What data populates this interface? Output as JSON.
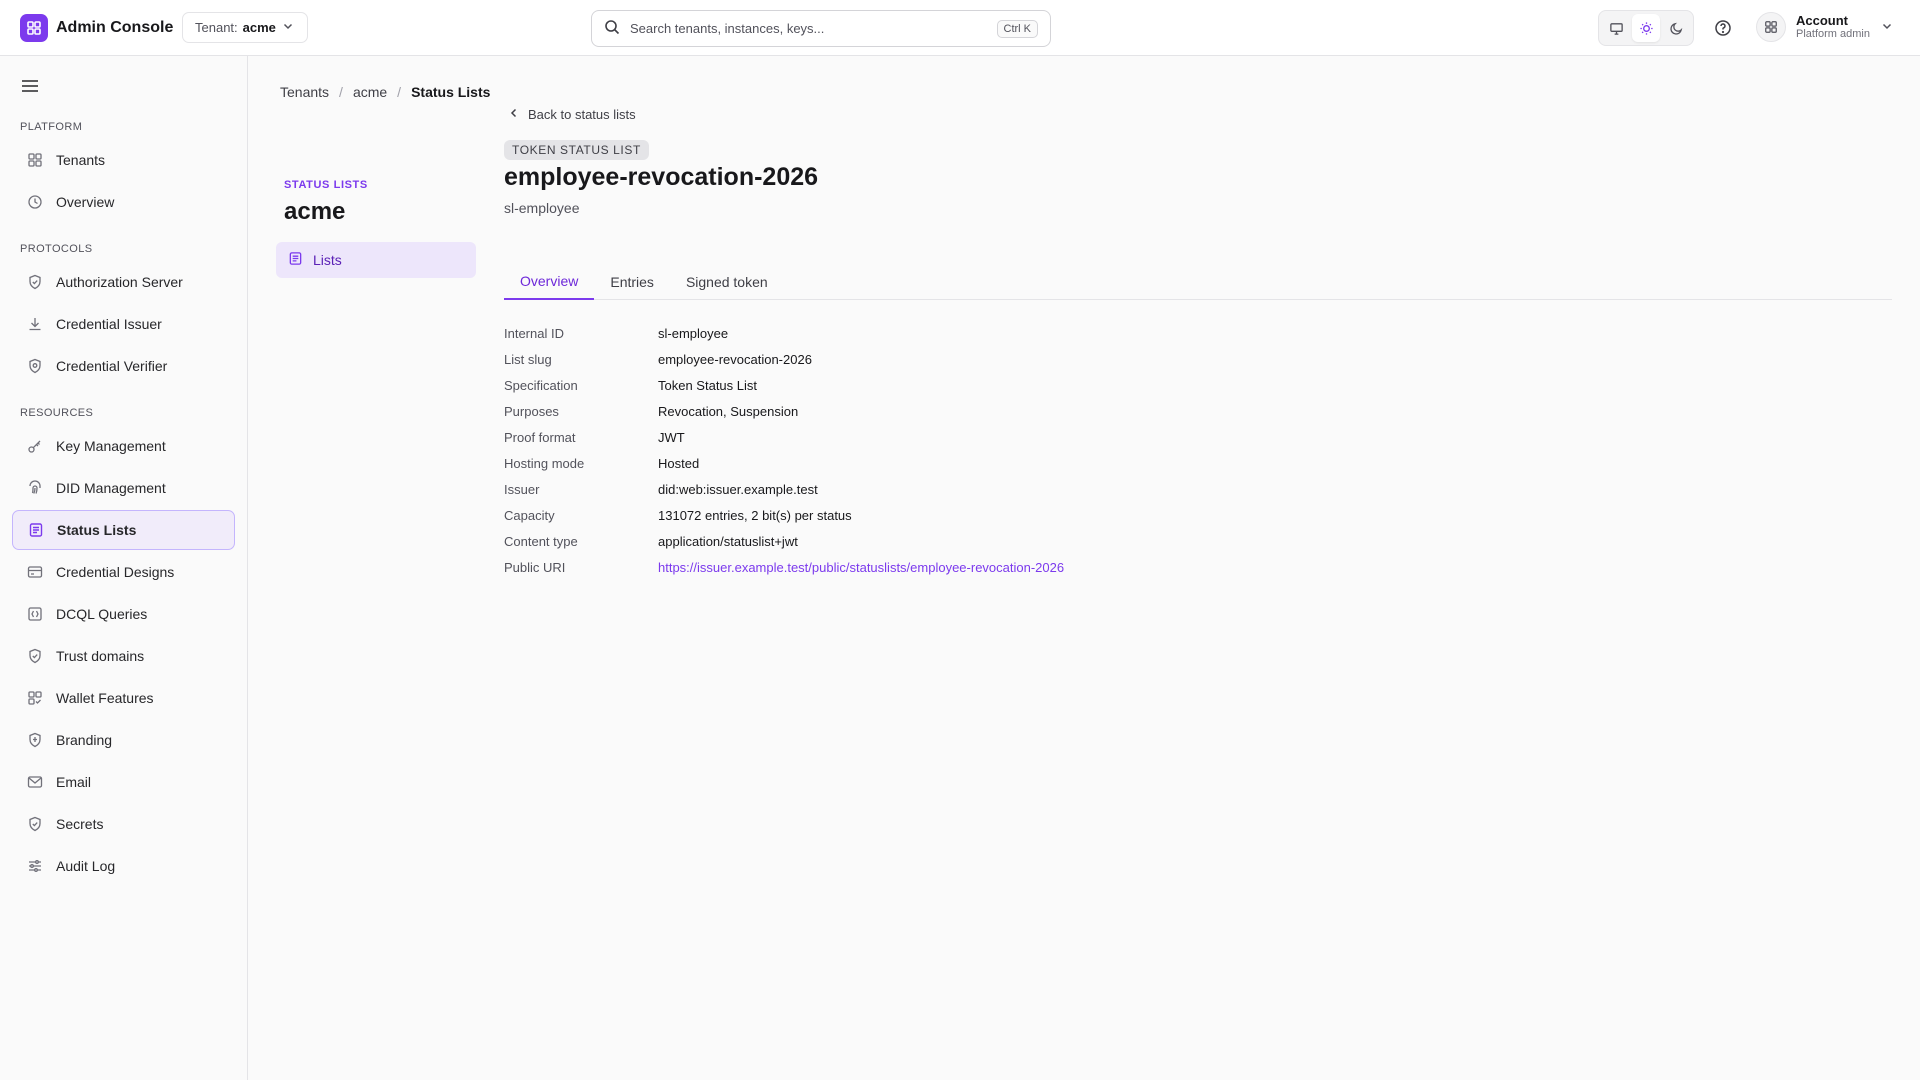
{
  "app": {
    "name": "Admin Console",
    "tenant_label": "Tenant:",
    "tenant_value": "acme",
    "search_placeholder": "Search tenants, instances, keys...",
    "search_shortcut": "Ctrl K",
    "theme_options": [
      "monitor-icon",
      "sun-icon",
      "moon-icon"
    ],
    "theme_selected": "sun-icon",
    "account_name": "Account",
    "account_role": "Platform admin"
  },
  "colors": {
    "accent": "#7c3aed",
    "active_nav_bg": "#f1ecfa",
    "active_nav_border": "#c4b5fd"
  },
  "sidebar": {
    "sections": [
      {
        "label": "PLATFORM",
        "items": [
          {
            "label": "Tenants",
            "icon": "grid-icon"
          },
          {
            "label": "Overview",
            "icon": "clock-icon"
          }
        ]
      },
      {
        "label": "PROTOCOLS",
        "items": [
          {
            "label": "Authorization Server",
            "icon": "shield-check-icon"
          },
          {
            "label": "Credential Issuer",
            "icon": "download-icon"
          },
          {
            "label": "Credential Verifier",
            "icon": "shield-icon"
          }
        ]
      },
      {
        "label": "RESOURCES",
        "items": [
          {
            "label": "Key Management",
            "icon": "key-icon"
          },
          {
            "label": "DID Management",
            "icon": "fingerprint-icon"
          },
          {
            "label": "Status Lists",
            "icon": "list-icon",
            "active": true
          },
          {
            "label": "Credential Designs",
            "icon": "card-icon"
          },
          {
            "label": "DCQL Queries",
            "icon": "query-icon"
          },
          {
            "label": "Trust domains",
            "icon": "shield-check-icon"
          },
          {
            "label": "Wallet Features",
            "icon": "grid-check-icon"
          },
          {
            "label": "Branding",
            "icon": "badge-icon"
          },
          {
            "label": "Email",
            "icon": "mail-icon"
          },
          {
            "label": "Secrets",
            "icon": "shield-check-icon"
          },
          {
            "label": "Audit Log",
            "icon": "sliders-icon"
          }
        ]
      }
    ]
  },
  "breadcrumb": [
    "Tenants",
    "acme",
    "Status Lists"
  ],
  "subnav": {
    "label": "STATUS LISTS",
    "title": "acme",
    "item": "Lists"
  },
  "detail": {
    "back_label": "Back to status lists",
    "badge": "TOKEN STATUS LIST",
    "title": "employee-revocation-2026",
    "subtitle": "sl-employee",
    "tabs": [
      "Overview",
      "Entries",
      "Signed token"
    ],
    "active_tab": "Overview",
    "properties": [
      {
        "label": "Internal ID",
        "value": "sl-employee"
      },
      {
        "label": "List slug",
        "value": "employee-revocation-2026"
      },
      {
        "label": "Specification",
        "value": "Token Status List"
      },
      {
        "label": "Purposes",
        "value": "Revocation, Suspension"
      },
      {
        "label": "Proof format",
        "value": "JWT"
      },
      {
        "label": "Hosting mode",
        "value": "Hosted"
      },
      {
        "label": "Issuer",
        "value": "did:web:issuer.example.test"
      },
      {
        "label": "Capacity",
        "value": "131072 entries, 2 bit(s) per status"
      },
      {
        "label": "Content type",
        "value": "application/statuslist+jwt"
      },
      {
        "label": "Public URI",
        "value": "https://issuer.example.test/public/statuslists/employee-revocation-2026",
        "link": true
      }
    ]
  }
}
